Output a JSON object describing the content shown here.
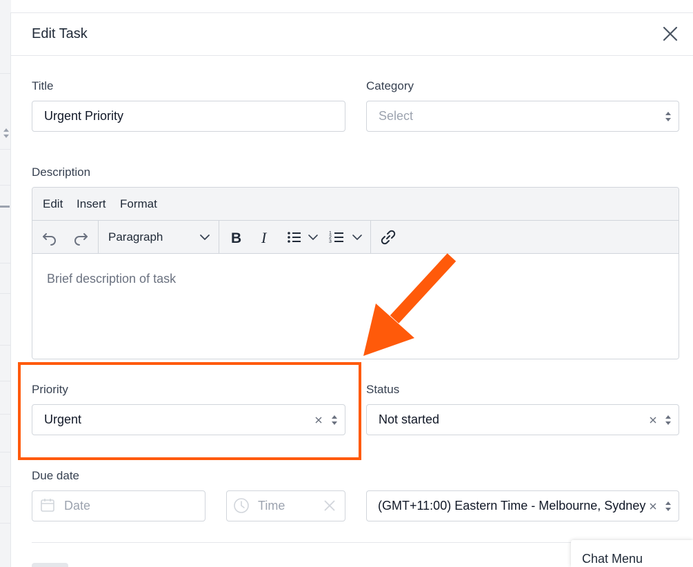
{
  "modal": {
    "title": "Edit Task"
  },
  "form": {
    "title_label": "Title",
    "title_value": "Urgent Priority",
    "category_label": "Category",
    "category_placeholder": "Select",
    "description_label": "Description",
    "editor": {
      "menus": [
        "Edit",
        "Insert",
        "Format"
      ],
      "block_format": "Paragraph",
      "placeholder": "Brief description of task"
    },
    "priority_label": "Priority",
    "priority_value": "Urgent",
    "status_label": "Status",
    "status_value": "Not started",
    "due_date_label": "Due date",
    "date_placeholder": "Date",
    "time_placeholder": "Time",
    "timezone_value": "(GMT+11:00) Eastern Time - Melbourne, Sydney"
  },
  "chat_menu": {
    "label": "Chat Menu"
  },
  "colors": {
    "annotation": "#ff5a0a",
    "border": "#d1d5db",
    "toolbar_bg": "#f3f4f6"
  },
  "icons": [
    "close-icon",
    "undo-icon",
    "redo-icon",
    "chevron-down-icon",
    "bold-icon",
    "italic-icon",
    "bullet-list-icon",
    "numbered-list-icon",
    "link-icon",
    "calendar-icon",
    "clock-icon",
    "clear-icon",
    "sort-arrows-icon"
  ]
}
